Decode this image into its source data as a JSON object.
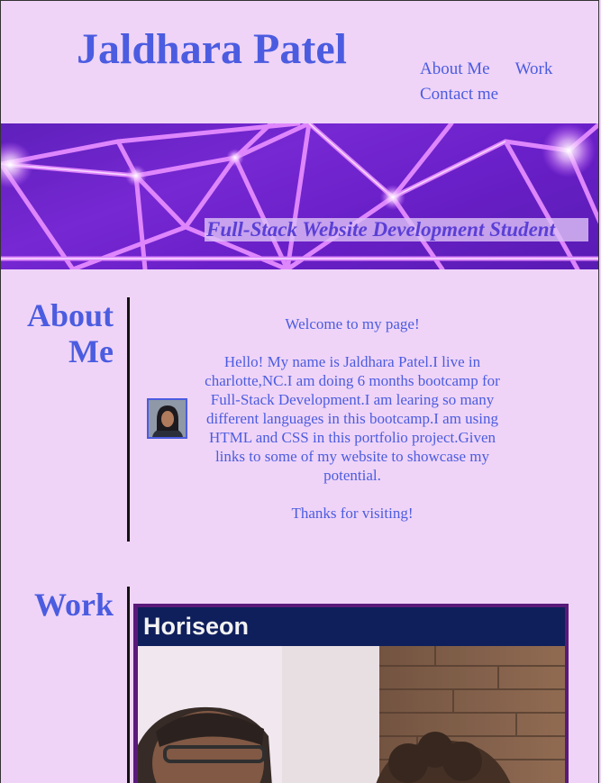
{
  "header": {
    "title": "Jaldhara Patel",
    "nav": {
      "about": "About Me",
      "work": "Work",
      "contact": "Contact me"
    }
  },
  "hero": {
    "caption": "Full-Stack Website Development Student"
  },
  "about": {
    "heading_line1": "About",
    "heading_line2": "Me",
    "welcome": "Welcome to my page!",
    "bio": "Hello! My name is Jaldhara Patel.I live in charlotte,NC.I am doing 6 months bootcamp for Full-Stack Development.I am learing so many different languages in this bootcamp.I am using HTML and CSS in this portfolio project.Given links to some of my website to showcase my potential.",
    "thanks": "Thanks for visiting!"
  },
  "work": {
    "heading": "Work",
    "project_title": "Horiseon"
  },
  "colors": {
    "background": "#efd4f7",
    "accent": "#4b5ce0",
    "hero": "#6a1fc9",
    "card_border": "#5a1a7a",
    "card_header": "#0f1f5c"
  }
}
